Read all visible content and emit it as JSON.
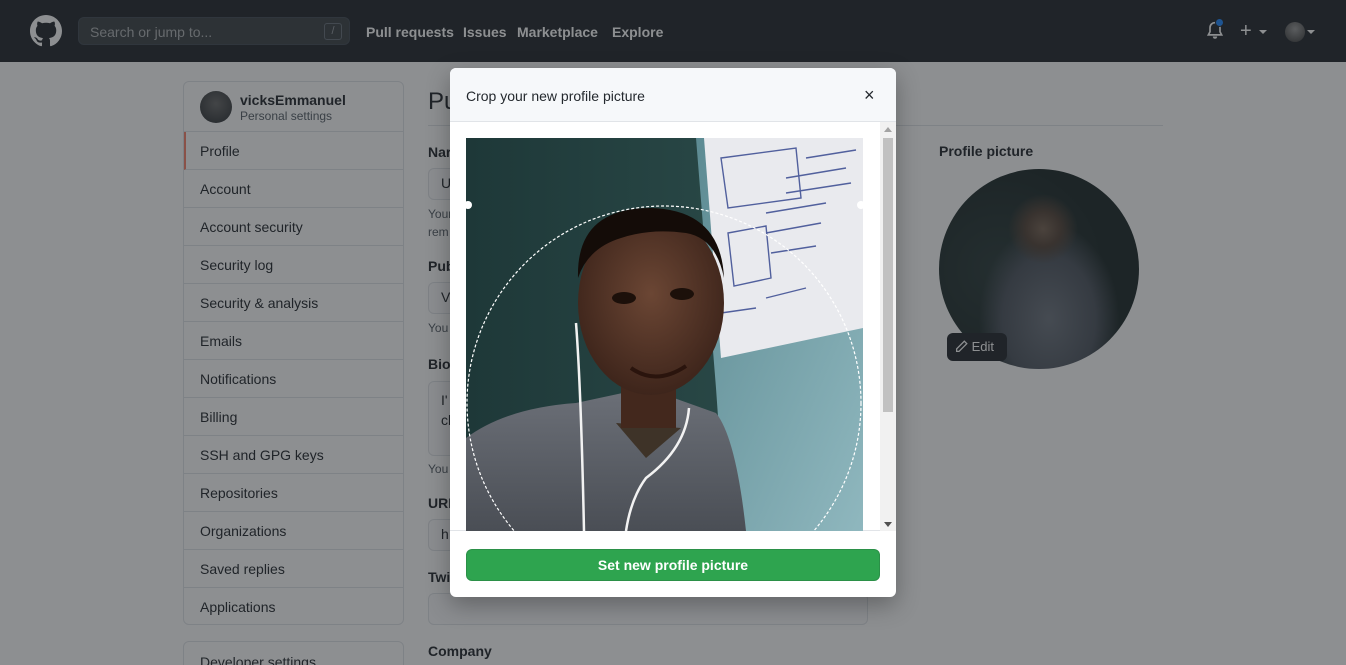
{
  "header": {
    "search_placeholder": "Search or jump to...",
    "search_shortcut": "/",
    "nav": [
      "Pull requests",
      "Issues",
      "Marketplace",
      "Explore"
    ]
  },
  "sidebar": {
    "username": "vicksEmmanuel",
    "subtitle": "Personal settings",
    "items": [
      {
        "label": "Profile",
        "active": true
      },
      {
        "label": "Account"
      },
      {
        "label": "Account security"
      },
      {
        "label": "Security log"
      },
      {
        "label": "Security & analysis"
      },
      {
        "label": "Emails"
      },
      {
        "label": "Notifications"
      },
      {
        "label": "Billing"
      },
      {
        "label": "SSH and GPG keys"
      },
      {
        "label": "Repositories"
      },
      {
        "label": "Organizations"
      },
      {
        "label": "Saved replies"
      },
      {
        "label": "Applications"
      }
    ],
    "developer_settings": "Developer settings"
  },
  "main": {
    "title_partial": "Pu",
    "name_label": "Nar",
    "name_value": "U",
    "name_note_1": "Your",
    "name_note_2": "rem",
    "email_label": "Pub",
    "email_value": "V",
    "email_note": "You",
    "bio_label": "Bio",
    "bio_line_1": "I'",
    "bio_line_2": "cl",
    "bio_note": "You",
    "url_label": "URL",
    "url_value": "h",
    "twitter_label": "Twi",
    "company_label": "Company",
    "profile_picture_label": "Profile picture",
    "edit_label": "Edit"
  },
  "modal": {
    "title": "Crop your new profile picture",
    "close": "×",
    "submit_label": "Set new profile picture"
  },
  "colors": {
    "header_bg": "#24292e",
    "primary_button": "#2ea44f",
    "active_tab_accent": "#f9826c",
    "notification_dot": "#2188ff"
  }
}
